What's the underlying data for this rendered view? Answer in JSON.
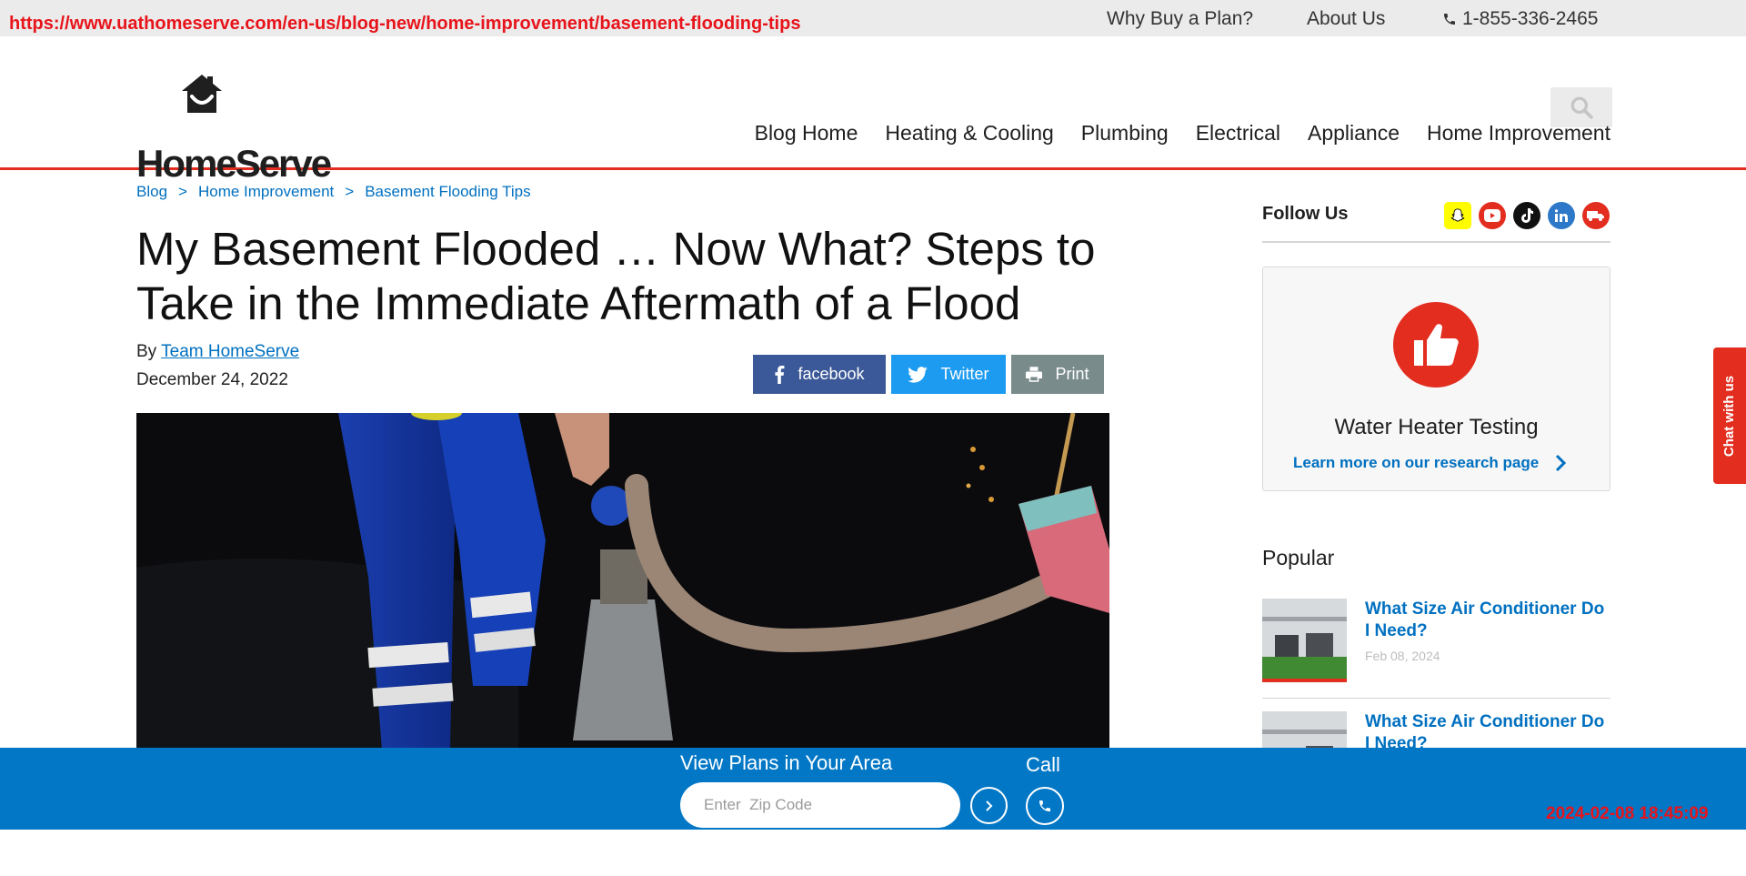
{
  "url_stamp": "https://www.uathomeserve.com/en-us/blog-new/home-improvement/basement-flooding-tips",
  "utility_nav": {
    "why_buy": "Why Buy a Plan?",
    "about": "About Us",
    "phone": "1-855-336-2465"
  },
  "logo": {
    "text": "HomeServe"
  },
  "main_nav": [
    "Blog Home",
    "Heating & Cooling",
    "Plumbing",
    "Electrical",
    "Appliance",
    "Home Improvement"
  ],
  "breadcrumb": [
    "Blog",
    "Home Improvement",
    "Basement Flooding Tips"
  ],
  "breadcrumb_sep": ">",
  "article": {
    "title": "My Basement Flooded … Now What? Steps to Take in the Immediate Aftermath of a Flood",
    "by_prefix": "By",
    "author": "Team HomeServe",
    "date": "December 24, 2022"
  },
  "share": {
    "facebook": "facebook",
    "twitter": "Twitter",
    "print": "Print"
  },
  "sidebar": {
    "follow_label": "Follow Us",
    "promo_title": "Water Heater Testing",
    "promo_link": "Learn more on our research page",
    "popular_title": "Popular",
    "popular": [
      {
        "title": "What Size Air Conditioner Do I Need?",
        "date": "Feb 08, 2024"
      },
      {
        "title": "What Size Air Conditioner Do I Need?",
        "date": ""
      }
    ]
  },
  "chat_tab": "Chat with us",
  "bottom_bar": {
    "plans_label": "View Plans in Your Area",
    "zip_placeholder": "Enter  Zip Code",
    "call_label": "Call"
  },
  "timestamp": "2024-02-08 18:45:09",
  "colors": {
    "brand_red": "#e22d1f",
    "link_blue": "#0070c0",
    "bar_blue": "#0277c6"
  }
}
